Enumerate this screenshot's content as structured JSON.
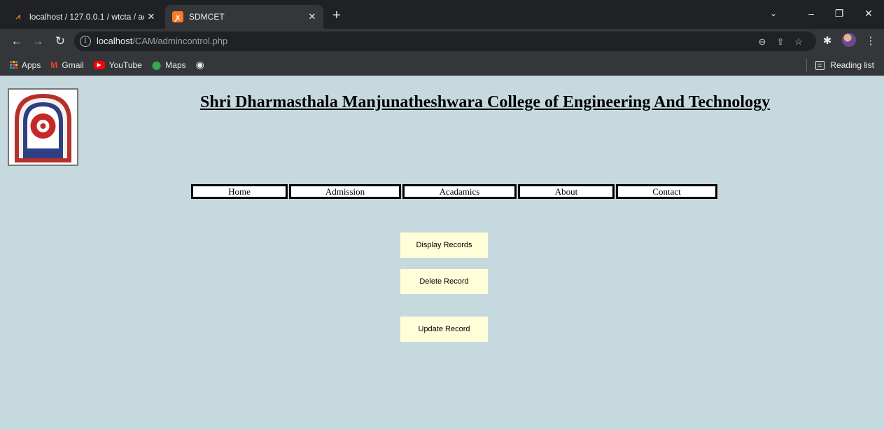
{
  "browser": {
    "tabs": [
      {
        "title": "localhost / 127.0.0.1 / wtcta / adr",
        "active": false,
        "icon": "phpmyadmin-icon"
      },
      {
        "title": "SDMCET",
        "active": true,
        "icon": "xampp-icon"
      }
    ],
    "address": {
      "host": "localhost",
      "path": "/CAM/admincontrol.php"
    },
    "bookmarks": [
      {
        "label": "Apps",
        "icon": "apps-grid-icon"
      },
      {
        "label": "Gmail",
        "icon": "gmail-icon"
      },
      {
        "label": "YouTube",
        "icon": "youtube-icon"
      },
      {
        "label": "Maps",
        "icon": "maps-icon"
      },
      {
        "label": "",
        "icon": "globe-icon"
      }
    ],
    "reading_list_label": "Reading list"
  },
  "page": {
    "title": "Shri Dharmasthala Manjunatheshwara College of Engineering And Technology",
    "nav": [
      "Home",
      "Admission",
      "Acadamics",
      "About",
      "Contact"
    ],
    "actions": [
      "Display Records",
      "Delete Record",
      "Update Record"
    ]
  },
  "colors": {
    "page_background": "#c5d9df",
    "button_background": "#fffed9",
    "chrome_dark": "#202124",
    "chrome_toolbar": "#35363a"
  }
}
